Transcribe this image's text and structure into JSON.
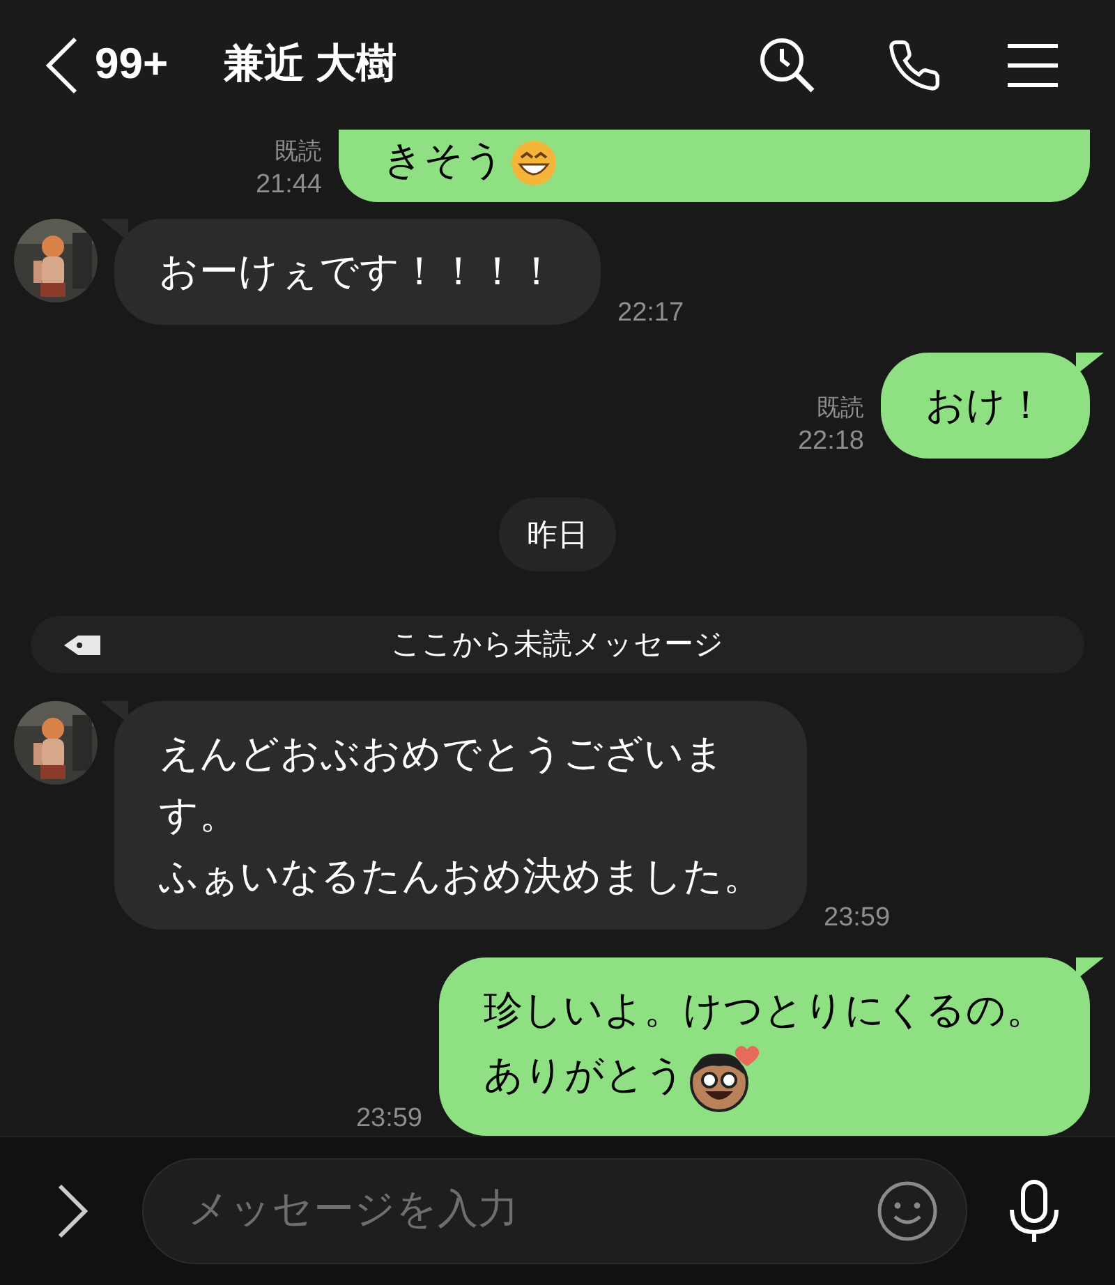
{
  "header": {
    "back_count": "99+",
    "title": "兼近 大樹"
  },
  "messages": [
    {
      "kind": "sent",
      "clipped_top": true,
      "lines": [
        "きそう"
      ],
      "emoji": {
        "kind": "grin"
      },
      "read_label": "既読",
      "time": "21:44"
    },
    {
      "kind": "received",
      "lines": [
        "おーけぇです！！！！"
      ],
      "time": "22:17"
    },
    {
      "kind": "sent",
      "lines": [
        "おけ！"
      ],
      "read_label": "既読",
      "time": "22:18"
    },
    {
      "kind": "date",
      "text": "昨日"
    },
    {
      "kind": "unread",
      "text": "ここから未読メッセージ"
    },
    {
      "kind": "received",
      "lines": [
        "えんどおぶおめでとうございま",
        "す。",
        "ふぁいなるたんおめ決めました。"
      ],
      "time": "23:59"
    },
    {
      "kind": "sent",
      "lines": [
        "珍しいよ。けつとりにくるの。",
        "ありがとう"
      ],
      "emoji": {
        "kind": "sticker"
      },
      "time": "23:59"
    }
  ],
  "input": {
    "placeholder": "メッセージを入力"
  }
}
